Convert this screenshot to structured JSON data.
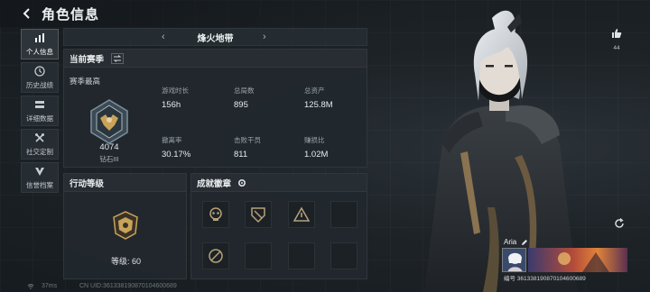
{
  "header": {
    "title": "角色信息"
  },
  "sidebar": {
    "items": [
      {
        "label": "个人信息",
        "icon": "bar-chart-icon",
        "active": true
      },
      {
        "label": "历史战绩",
        "icon": "history-clock-icon",
        "active": false
      },
      {
        "label": "详细数据",
        "icon": "data-cards-icon",
        "active": false
      },
      {
        "label": "社交定制",
        "icon": "wrench-tools-icon",
        "active": false
      },
      {
        "label": "信誉档案",
        "icon": "shield-badge-icon",
        "active": false
      }
    ]
  },
  "mode": {
    "name": "烽火地带"
  },
  "season": {
    "title": "当前赛季",
    "best_label": "赛季最高",
    "rank_score": "4074",
    "rank_name": "钻石III",
    "stats": [
      {
        "label": "游戏时长",
        "value": "156h"
      },
      {
        "label": "总局数",
        "value": "895"
      },
      {
        "label": "总资产",
        "value": "125.8M"
      },
      {
        "label": "撤离率",
        "value": "30.17%"
      },
      {
        "label": "击败干员",
        "value": "811"
      },
      {
        "label": "赚损比",
        "value": "1.02M"
      }
    ]
  },
  "level": {
    "title": "行动等级",
    "text": "等级: 60"
  },
  "achievements": {
    "title": "成就徽章",
    "slots_filled": 4,
    "slots_total": 8
  },
  "likes": {
    "count": "44"
  },
  "player": {
    "name": "Aria",
    "uid": "编号 361338190870104600689"
  },
  "status": {
    "latency": "37ms",
    "uid": "CN UID:361338190870104600689"
  },
  "colors": {
    "panel": "#22282e",
    "accent_gold": "#c9a35a",
    "text": "#d8dde0"
  }
}
